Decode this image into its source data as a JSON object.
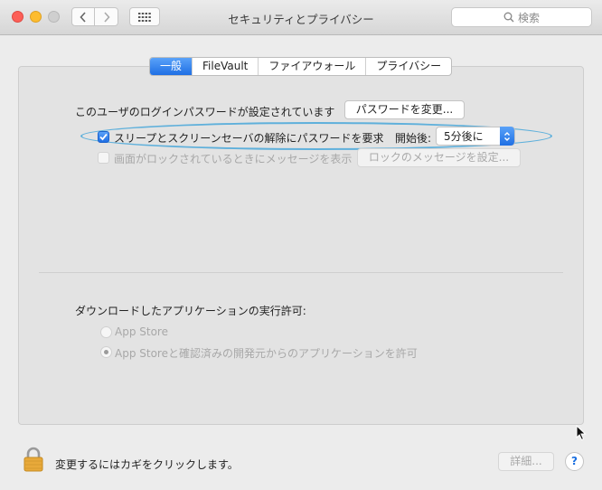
{
  "window": {
    "title": "セキュリティとプライバシー",
    "search_placeholder": "検索"
  },
  "tabs": [
    {
      "label": "一般",
      "active": true
    },
    {
      "label": "FileVault",
      "active": false
    },
    {
      "label": "ファイアウォール",
      "active": false
    },
    {
      "label": "プライバシー",
      "active": false
    }
  ],
  "general": {
    "password_status": "このユーザのログインパスワードが設定されています",
    "change_password_button": "パスワードを変更...",
    "require_password": {
      "label": "スリープとスクリーンセーバの解除にパスワードを要求",
      "checked": true,
      "after_label": "開始後:",
      "after_value": "5分後に"
    },
    "lock_message": {
      "label": "画面がロックされているときにメッセージを表示",
      "checked": false,
      "button": "ロックのメッセージを設定..."
    }
  },
  "downloads": {
    "heading": "ダウンロードしたアプリケーションの実行許可:",
    "options": [
      {
        "label": "App Store",
        "selected": false
      },
      {
        "label": "App Storeと確認済みの開発元からのアプリケーションを許可",
        "selected": true
      }
    ]
  },
  "footer": {
    "lock_text": "変更するにはカギをクリックします。",
    "advanced_button": "詳細...",
    "help_label": "?"
  },
  "colors": {
    "accent": "#1f6fe4",
    "highlight_oval": "#5fb0db",
    "lock": "#e8a93a"
  }
}
